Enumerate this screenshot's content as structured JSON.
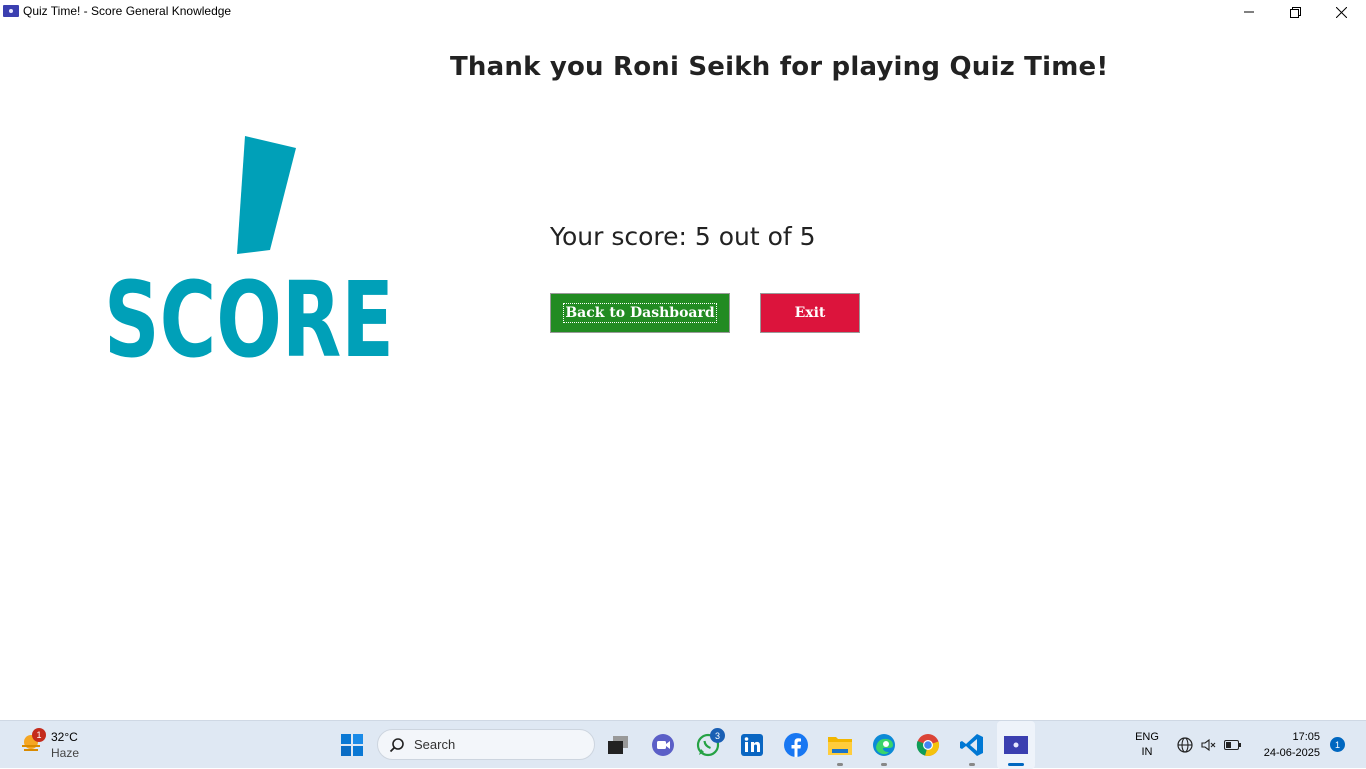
{
  "window": {
    "title": "Quiz Time! - Score General Knowledge"
  },
  "main": {
    "heading": "Thank you Roni Seikh for playing Quiz Time!",
    "score_text": "Your score: 5 out of 5",
    "back_button": "Back to Dashboard",
    "exit_button": "Exit",
    "logo_text": "SCORE"
  },
  "colors": {
    "logo": "#00a0b8",
    "back_button": "#228b22",
    "exit_button": "#dc143c"
  },
  "taskbar": {
    "weather": {
      "badge": "1",
      "temp": "32°C",
      "condition": "Haze"
    },
    "search_placeholder": "Search",
    "whatsapp_badge": "3",
    "language": {
      "line1": "ENG",
      "line2": "IN"
    },
    "time": "17:05",
    "date": "24-06-2025",
    "notifications": "1"
  }
}
